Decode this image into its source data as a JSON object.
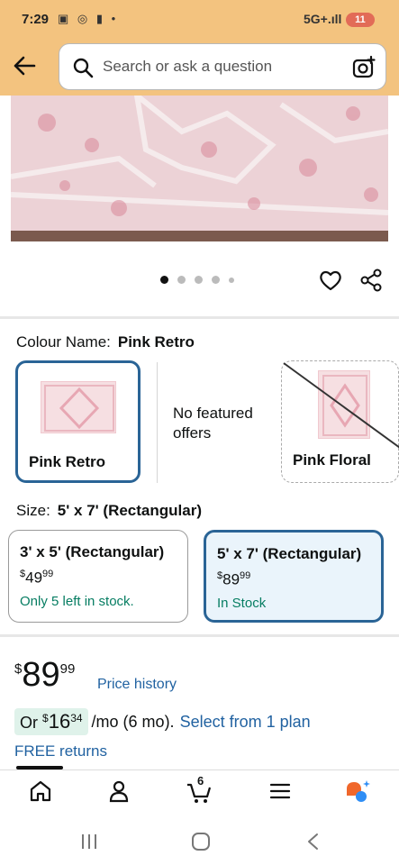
{
  "status_bar": {
    "time": "7:29",
    "left_icons": "▣ ◎ ▮ •",
    "network": "5G+.ıll",
    "battery": "11"
  },
  "search": {
    "placeholder": "Search or ask a question"
  },
  "carousel": {
    "dot_count": 5,
    "active_index": 0
  },
  "colour": {
    "label": "Colour Name:",
    "selected": "Pink Retro",
    "options": [
      {
        "name": "Pink Retro",
        "state": "selected"
      },
      {
        "name": "No featured offers",
        "state": "info"
      },
      {
        "name": "Pink Floral",
        "state": "unavailable"
      }
    ]
  },
  "no_featured": {
    "line1": "No featured",
    "line2": "offers"
  },
  "size": {
    "label": "Size:",
    "selected": "5' x 7' (Rectangular)",
    "options": [
      {
        "title": "3' x 5' (Rectangular)",
        "price_whole": "49",
        "price_frac": "99",
        "currency": "$",
        "stock": "Only 5 left in stock."
      },
      {
        "title": "5' x 7' (Rectangular)",
        "price_whole": "89",
        "price_frac": "99",
        "currency": "$",
        "stock": "In Stock"
      }
    ]
  },
  "price": {
    "currency": "$",
    "whole": "89",
    "fraction": "99",
    "history_link": "Price history"
  },
  "installment": {
    "prefix": "Or",
    "currency": "$",
    "whole": "16",
    "fraction": "34",
    "suffix": "/mo (6 mo).",
    "link": "Select from 1 plan"
  },
  "returns": "FREE returns",
  "bottom_nav": {
    "cart_count": "6",
    "items": [
      "home-icon",
      "account-icon",
      "cart-icon",
      "menu-icon",
      "rufus-ai-icon"
    ]
  },
  "colors": {
    "header_bg": "#f3c37f",
    "selected_border": "#2a6496",
    "link": "#2162a1",
    "stock_green": "#067d62"
  }
}
